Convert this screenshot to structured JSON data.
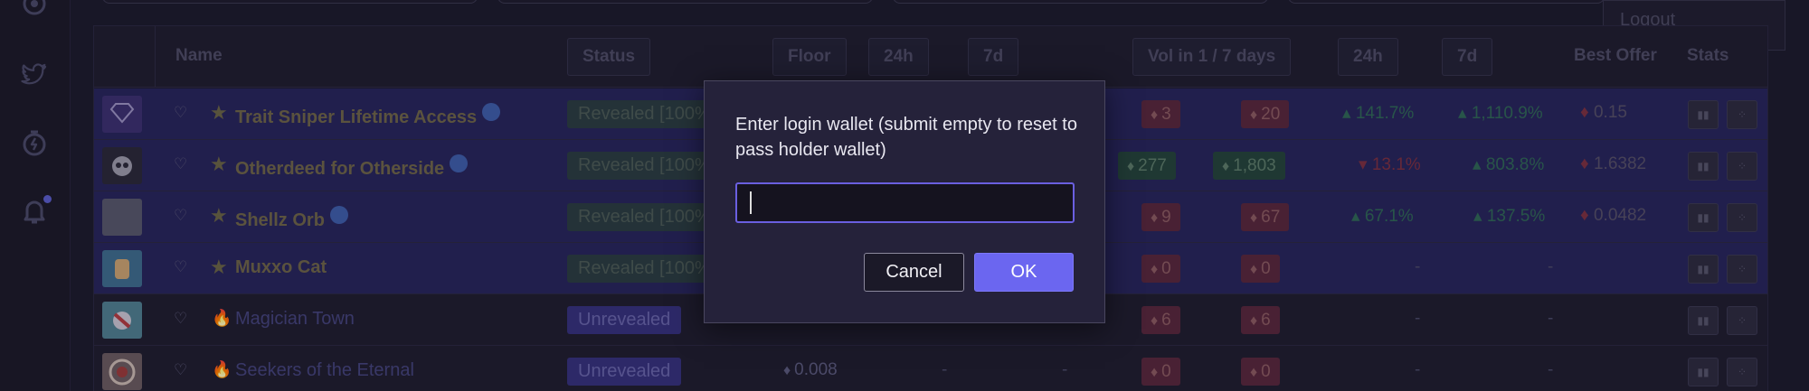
{
  "dropdown": {
    "logout_label": "Logout"
  },
  "table": {
    "headers": {
      "name": "Name",
      "status": "Status",
      "floor": "Floor",
      "h24": "24h",
      "d7": "7d",
      "vol": "Vol in 1 / 7 days",
      "vol24": "24h",
      "vol7": "7d",
      "best_offer": "Best Offer",
      "stats": "Stats"
    },
    "rows": [
      {
        "name": "Trait Sniper Lifetime Access",
        "status": "Revealed [100%",
        "vol1": "3",
        "vol7": "20",
        "chg24": "141.7%",
        "chg7": "1,110.9%",
        "offer": "0.15"
      },
      {
        "name": "Otherdeed for Otherside",
        "status": "Revealed [100%",
        "vol1": "277",
        "vol7": "1,803",
        "chg24": "13.1%",
        "chg7": "803.8%",
        "offer": "1.6382"
      },
      {
        "name": "Shellz Orb",
        "status": "Revealed [100%",
        "vol1": "9",
        "vol7": "67",
        "chg24": "67.1%",
        "chg7": "137.5%",
        "offer": "0.0482"
      },
      {
        "name": "Muxxo Cat",
        "status": "Revealed [100%",
        "vol1": "0",
        "vol7": "0",
        "chg24": "-",
        "chg7": "-",
        "offer": ""
      },
      {
        "name": "Magician Town",
        "status": "Unrevealed",
        "vol1": "6",
        "vol7": "6",
        "chg24": "-",
        "chg7": "-",
        "offer": ""
      },
      {
        "name": "Seekers of the Eternal",
        "status": "Unrevealed",
        "floor": "0.008",
        "f24": "-",
        "f7": "-",
        "vol1": "0",
        "vol7": "0",
        "chg24": "-",
        "chg7": "-",
        "offer": ""
      }
    ]
  },
  "modal": {
    "message": "Enter login wallet (submit empty to reset to pass holder wallet)",
    "input_value": "",
    "cancel_label": "Cancel",
    "ok_label": "OK"
  },
  "icons": {
    "rail": [
      "target-icon",
      "twitter-icon",
      "stopwatch-icon",
      "bell-icon"
    ],
    "row_actions": [
      "bar-chart-icon",
      "scatter-icon"
    ]
  },
  "colors": {
    "accent": "#6b66f0",
    "highlight_row": "#27245a",
    "negative": "#7a2f40",
    "positive": "#2f6655"
  }
}
